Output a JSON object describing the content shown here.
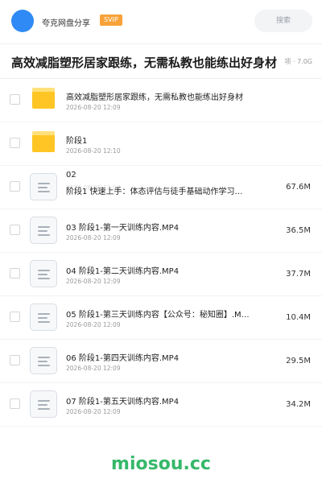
{
  "header": {
    "share_name": "夸克网盘分享",
    "badge": "SVIP",
    "search_label": "搜索"
  },
  "title": {
    "text": "高效减脂塑形居家跟练，无需私教也能练出好身材",
    "meta": "项 · 7.0G"
  },
  "files": [
    {
      "type": "folder",
      "name": "高效减脂塑形居家跟练，无需私教也能练出好身材",
      "date": "2026-08-20 12:09",
      "size": ""
    },
    {
      "type": "folder",
      "name": "阶段1",
      "date": "2026-08-20 12:10",
      "size": ""
    },
    {
      "type": "file",
      "name": "02",
      "name2": "阶段1 快速上手：体态评估与徒手基础动作学习…",
      "date": "2026-08-20 12:09",
      "size": "67.6M"
    },
    {
      "type": "file",
      "name": "03 阶段1-第一天训练内容.MP4",
      "date": "2026-08-20 12:09",
      "size": "36.5M"
    },
    {
      "type": "file",
      "name": "04 阶段1-第二天训练内容.MP4",
      "date": "2026-08-20 12:09",
      "size": "37.7M"
    },
    {
      "type": "file",
      "name": "05 阶段1-第三天训练内容【公众号：秘知圈】.M…",
      "date": "2026-08-20 12:09",
      "size": "10.4M"
    },
    {
      "type": "file",
      "name": "06 阶段1-第四天训练内容.MP4",
      "date": "2026-08-20 12:09",
      "size": "29.5M"
    },
    {
      "type": "file",
      "name": "07 阶段1-第五天训练内容.MP4",
      "date": "2026-08-20 12:09",
      "size": "34.2M"
    }
  ],
  "watermark": "miosou.cc",
  "colors": {
    "accent": "#2f8af5",
    "badge": "#f7a238",
    "folder": "#ffc524",
    "watermark": "#36b86a"
  }
}
